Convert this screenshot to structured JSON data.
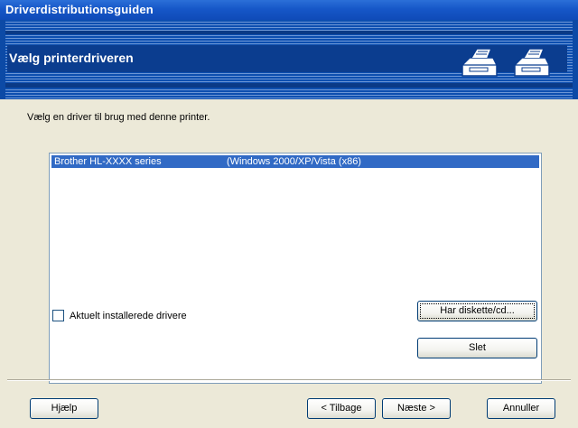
{
  "window": {
    "title": "Driverdistributionsguiden"
  },
  "banner": {
    "heading": "Vælg printerdriveren"
  },
  "main": {
    "instruction": "Vælg en driver til brug med denne printer.",
    "drivers": [
      {
        "name": "Brother HL-XXXX series",
        "platform": "(Windows 2000/XP/Vista (x86)"
      }
    ],
    "checkbox_label": "Aktuelt installerede drivere",
    "have_disk_label": "Har diskette/cd...",
    "delete_label": "Slet"
  },
  "footer": {
    "help_label": "Hjælp",
    "back_label": "< Tilbage",
    "next_label": "Næste >",
    "cancel_label": "Annuller"
  }
}
